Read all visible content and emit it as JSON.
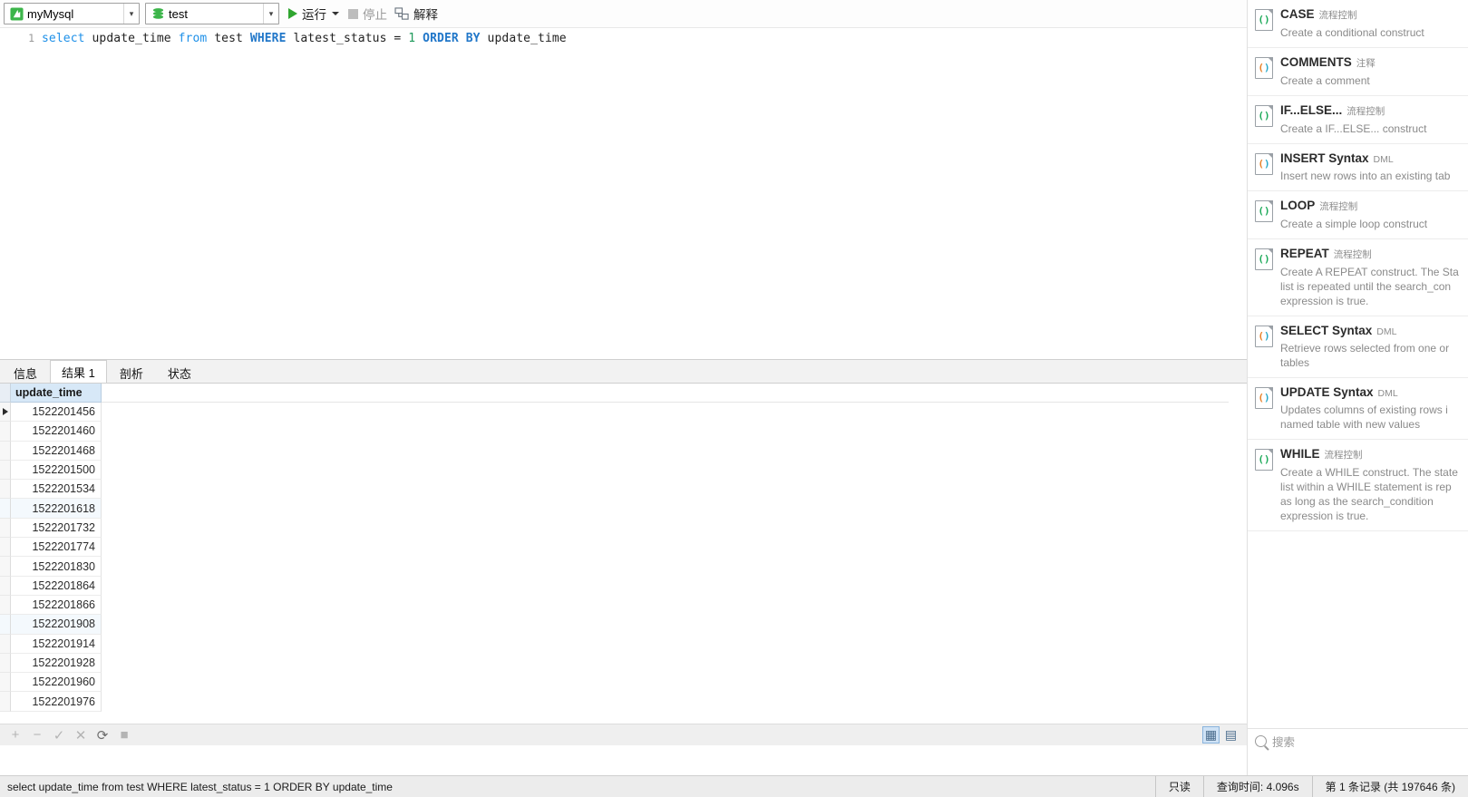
{
  "toolbar": {
    "connection": {
      "value": "myMysql",
      "icon": "connection-icon"
    },
    "database": {
      "value": "test",
      "icon": "database-icon"
    },
    "run_label": "运行",
    "stop_label": "停止",
    "explain_label": "解释"
  },
  "editor": {
    "line_number": "1",
    "tokens": [
      {
        "t": "select",
        "c": "kw"
      },
      {
        "t": " update_time ",
        "c": "pl"
      },
      {
        "t": "from",
        "c": "kw"
      },
      {
        "t": " test ",
        "c": "pl"
      },
      {
        "t": "WHERE",
        "c": "kw2"
      },
      {
        "t": " latest_status = ",
        "c": "pl"
      },
      {
        "t": "1",
        "c": "num"
      },
      {
        "t": " ",
        "c": "pl"
      },
      {
        "t": "ORDER",
        "c": "kw2"
      },
      {
        "t": " ",
        "c": "pl"
      },
      {
        "t": "BY",
        "c": "kw2"
      },
      {
        "t": " update_time",
        "c": "pl"
      }
    ],
    "plain_text": "select update_time from test WHERE latest_status = 1 ORDER BY update_time"
  },
  "result_tabs": [
    {
      "label": "信息",
      "active": false
    },
    {
      "label": "结果 1",
      "active": true
    },
    {
      "label": "剖析",
      "active": false
    },
    {
      "label": "状态",
      "active": false
    }
  ],
  "grid": {
    "columns": [
      "update_time"
    ],
    "rows": [
      [
        "1522201456"
      ],
      [
        "1522201460"
      ],
      [
        "1522201468"
      ],
      [
        "1522201500"
      ],
      [
        "1522201534"
      ],
      [
        "1522201618"
      ],
      [
        "1522201732"
      ],
      [
        "1522201774"
      ],
      [
        "1522201830"
      ],
      [
        "1522201864"
      ],
      [
        "1522201866"
      ],
      [
        "1522201908"
      ],
      [
        "1522201914"
      ],
      [
        "1522201928"
      ],
      [
        "1522201960"
      ],
      [
        "1522201976"
      ]
    ],
    "selected_row_index": 0
  },
  "grid_footer": {
    "buttons": [
      {
        "name": "add-record-button",
        "glyph": "+"
      },
      {
        "name": "delete-record-button",
        "glyph": "−"
      },
      {
        "name": "apply-change-button",
        "glyph": "✓"
      },
      {
        "name": "discard-change-button",
        "glyph": "✕"
      },
      {
        "name": "refresh-button",
        "glyph": "⟳"
      },
      {
        "name": "stop-button",
        "glyph": "■"
      }
    ],
    "view_toggles": [
      {
        "name": "grid-view-toggle",
        "glyph": "▦",
        "selected": true
      },
      {
        "name": "form-view-toggle",
        "glyph": "▤",
        "selected": false
      }
    ]
  },
  "statusbar": {
    "sql": "select update_time from test WHERE latest_status = 1 ORDER BY update_time",
    "readonly": "只读",
    "query_time": "查询时间: 4.096s",
    "record_info": "第 1 条记录 (共 197646 条)"
  },
  "snippets": {
    "search_placeholder": "搜索",
    "items": [
      {
        "title": "CASE",
        "category": "流程控制",
        "desc": "Create a conditional construct",
        "icon_color": "green"
      },
      {
        "title": "COMMENTS",
        "category": "注释",
        "desc": "Create a comment",
        "icon_color": "orange"
      },
      {
        "title": "IF...ELSE...",
        "category": "流程控制",
        "desc": "Create a IF...ELSE... construct",
        "icon_color": "green"
      },
      {
        "title": "INSERT Syntax",
        "category": "DML",
        "desc": "Insert new rows into an existing tab",
        "icon_color": "orange"
      },
      {
        "title": "LOOP",
        "category": "流程控制",
        "desc": "Create a simple loop construct",
        "icon_color": "green"
      },
      {
        "title": "REPEAT",
        "category": "流程控制",
        "desc": "Create A REPEAT construct. The Sta list is repeated until the search_con expression is true.",
        "icon_color": "green"
      },
      {
        "title": "SELECT Syntax",
        "category": "DML",
        "desc": "Retrieve rows selected from one or tables",
        "icon_color": "orange"
      },
      {
        "title": "UPDATE Syntax",
        "category": "DML",
        "desc": "Updates columns of existing rows i named table with new values",
        "icon_color": "orange"
      },
      {
        "title": "WHILE",
        "category": "流程控制",
        "desc": "Create a WHILE construct. The state list within a WHILE statement is rep as long as the search_condition expression is true.",
        "icon_color": "green"
      }
    ]
  }
}
